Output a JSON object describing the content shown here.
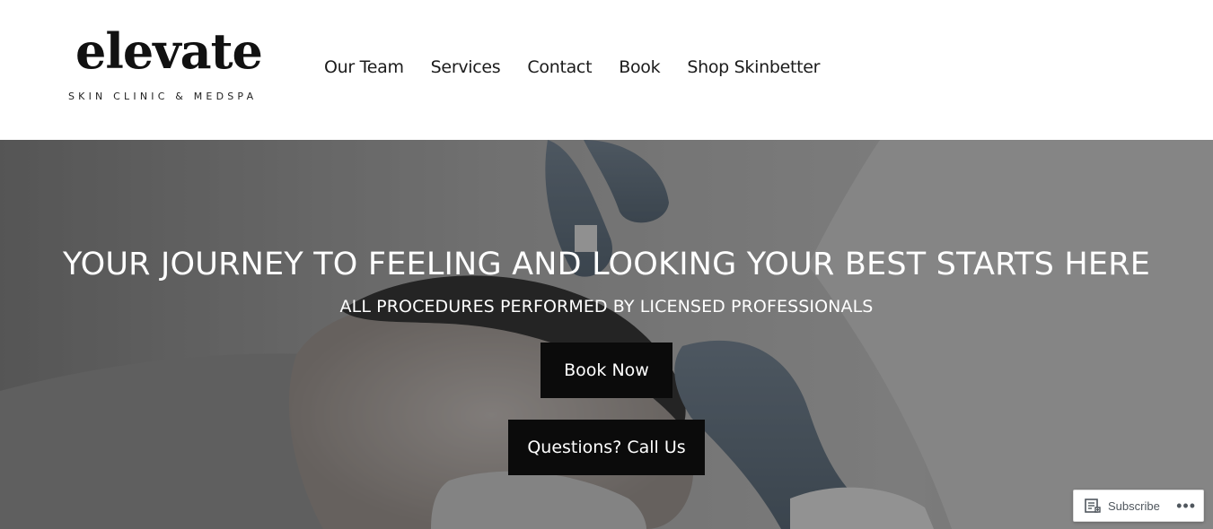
{
  "brand": {
    "name": "elevate",
    "tagline": "SKIN CLINIC & MEDSPA"
  },
  "nav": {
    "items": [
      {
        "label": "Our Team"
      },
      {
        "label": "Services"
      },
      {
        "label": "Contact"
      },
      {
        "label": "Book"
      },
      {
        "label": "Shop Skinbetter"
      }
    ]
  },
  "hero": {
    "title": "YOUR JOURNEY TO FEELING AND LOOKING YOUR BEST STARTS HERE",
    "subtitle": "ALL PROCEDURES PERFORMED BY LICENSED PROFESSIONALS",
    "book_label": "Book Now",
    "call_label": "Questions? Call Us"
  },
  "subscribe": {
    "label": "Subscribe",
    "icon": "reader-icon",
    "more_icon": "ellipsis-icon"
  },
  "colors": {
    "button_bg": "#0b0b0b",
    "nav_text": "#1b1b1b",
    "hero_text": "#ffffff"
  }
}
